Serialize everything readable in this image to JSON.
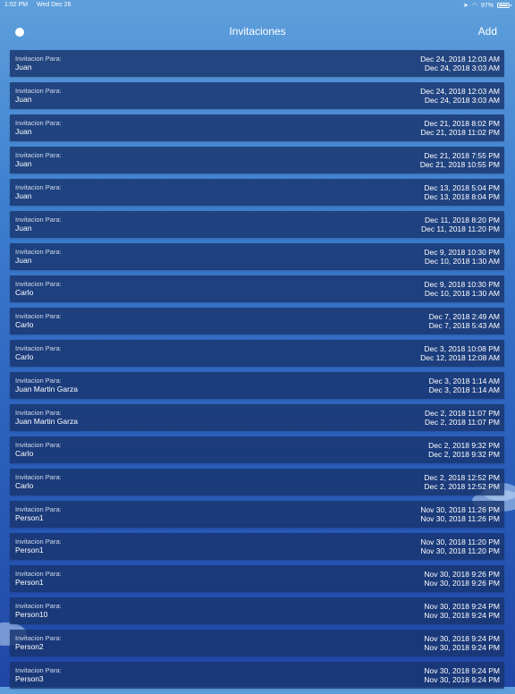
{
  "status_bar": {
    "time": "1:02 PM",
    "date": "Wed Dec 26",
    "battery": "97%",
    "signal_icon": "location-arrow-icon",
    "wifi_icon": "wifi-icon",
    "battery_icon": "battery-icon"
  },
  "nav": {
    "title": "Invitaciones",
    "add_label": "Add",
    "left_icon": "circle-icon"
  },
  "rows": [
    {
      "label": "Invitacion Para:",
      "name": "Juan",
      "start": "Dec 24, 2018 12:03 AM",
      "end": "Dec 24, 2018 3:03 AM"
    },
    {
      "label": "Invitacion Para:",
      "name": "Juan",
      "start": "Dec 24, 2018 12:03 AM",
      "end": "Dec 24, 2018 3:03 AM"
    },
    {
      "label": "Invitacion Para:",
      "name": "Juan",
      "start": "Dec 21, 2018 8:02 PM",
      "end": "Dec 21, 2018 11:02 PM"
    },
    {
      "label": "Invitacion Para:",
      "name": "Juan",
      "start": "Dec 21, 2018 7:55 PM",
      "end": "Dec 21, 2018 10:55 PM"
    },
    {
      "label": "Invitacion Para:",
      "name": "Juan",
      "start": "Dec 13, 2018 5:04 PM",
      "end": "Dec 13, 2018 8:04 PM"
    },
    {
      "label": "Invitacion Para:",
      "name": "Juan",
      "start": "Dec 11, 2018 8:20 PM",
      "end": "Dec 11, 2018 11:20 PM"
    },
    {
      "label": "Invitacion Para:",
      "name": "Juan",
      "start": "Dec 9, 2018 10:30 PM",
      "end": "Dec 10, 2018 1:30 AM"
    },
    {
      "label": "Invitacion Para:",
      "name": "Carlo",
      "start": "Dec 9, 2018 10:30 PM",
      "end": "Dec 10, 2018 1:30 AM"
    },
    {
      "label": "Invitacion Para:",
      "name": "Carlo",
      "start": "Dec 7, 2018 2:49 AM",
      "end": "Dec 7, 2018 5:43 AM"
    },
    {
      "label": "Invitacion Para:",
      "name": "Carlo",
      "start": "Dec 3, 2018 10:08 PM",
      "end": "Dec 12, 2018 12:08 AM"
    },
    {
      "label": "Invitacion Para:",
      "name": "Juan Martin Garza",
      "start": "Dec 3, 2018 1:14 AM",
      "end": "Dec 3, 2018 1:14 AM"
    },
    {
      "label": "Invitacion Para:",
      "name": "Juan Martin Garza",
      "start": "Dec 2, 2018 11:07 PM",
      "end": "Dec 2, 2018 11:07 PM"
    },
    {
      "label": "Invitacion Para:",
      "name": "Carlo",
      "start": "Dec 2, 2018 9:32 PM",
      "end": "Dec 2, 2018 9:32 PM"
    },
    {
      "label": "Invitacion Para:",
      "name": "Carlo",
      "start": "Dec 2, 2018 12:52 PM",
      "end": "Dec 2, 2018 12:52 PM"
    },
    {
      "label": "Invitacion Para:",
      "name": "Person1",
      "start": "Nov 30, 2018 11:26 PM",
      "end": "Nov 30, 2018 11:26 PM"
    },
    {
      "label": "Invitacion Para:",
      "name": "Person1",
      "start": "Nov 30, 2018 11:20 PM",
      "end": "Nov 30, 2018 11:20 PM"
    },
    {
      "label": "Invitacion Para:",
      "name": "Person1",
      "start": "Nov 30, 2018 9:26 PM",
      "end": "Nov 30, 2018 9:26 PM"
    },
    {
      "label": "Invitacion Para:",
      "name": "Person10",
      "start": "Nov 30, 2018 9:24 PM",
      "end": "Nov 30, 2018 9:24 PM"
    },
    {
      "label": "Invitacion Para:",
      "name": "Person2",
      "start": "Nov 30, 2018 9:24 PM",
      "end": "Nov 30, 2018 9:24 PM"
    },
    {
      "label": "Invitacion Para:",
      "name": "Person3",
      "start": "Nov 30, 2018 9:24 PM",
      "end": "Nov 30, 2018 9:24 PM"
    }
  ]
}
